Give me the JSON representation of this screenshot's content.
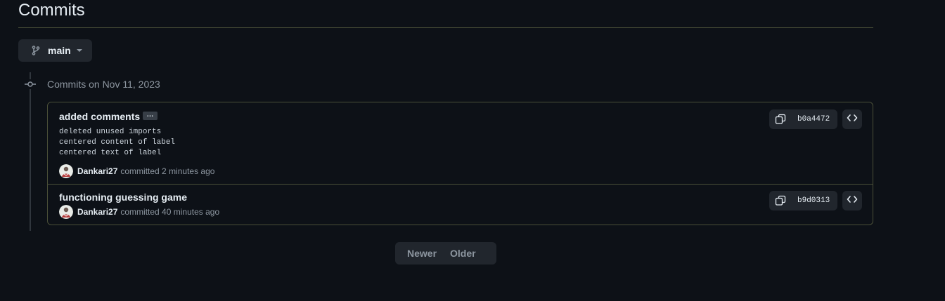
{
  "page": {
    "title": "Commits"
  },
  "branch": {
    "name": "main"
  },
  "group": {
    "heading": "Commits on Nov 11, 2023"
  },
  "commits": [
    {
      "title": "added comments",
      "ellipsis": "…",
      "body": [
        "deleted unused imports",
        "centered content of label",
        "centered text of label"
      ],
      "author": "Dankari27",
      "time": "committed 2 minutes ago",
      "sha": "b0a4472"
    },
    {
      "title": "functioning guessing game",
      "author": "Dankari27",
      "time": "committed 40 minutes ago",
      "sha": "b9d0313"
    }
  ],
  "pagination": {
    "newer": "Newer",
    "older": "Older"
  },
  "colors": {
    "background": "#0d1117",
    "surface": "#21262d",
    "border": "#4a4f38",
    "text": "#e6edf3",
    "muted": "#8d96a0"
  },
  "icons": {
    "branch": "git-branch-icon",
    "caret": "caret-down-icon",
    "commit_node": "git-commit-icon",
    "copy": "copy-icon",
    "browse": "code-icon",
    "avatar": "user-avatar"
  }
}
